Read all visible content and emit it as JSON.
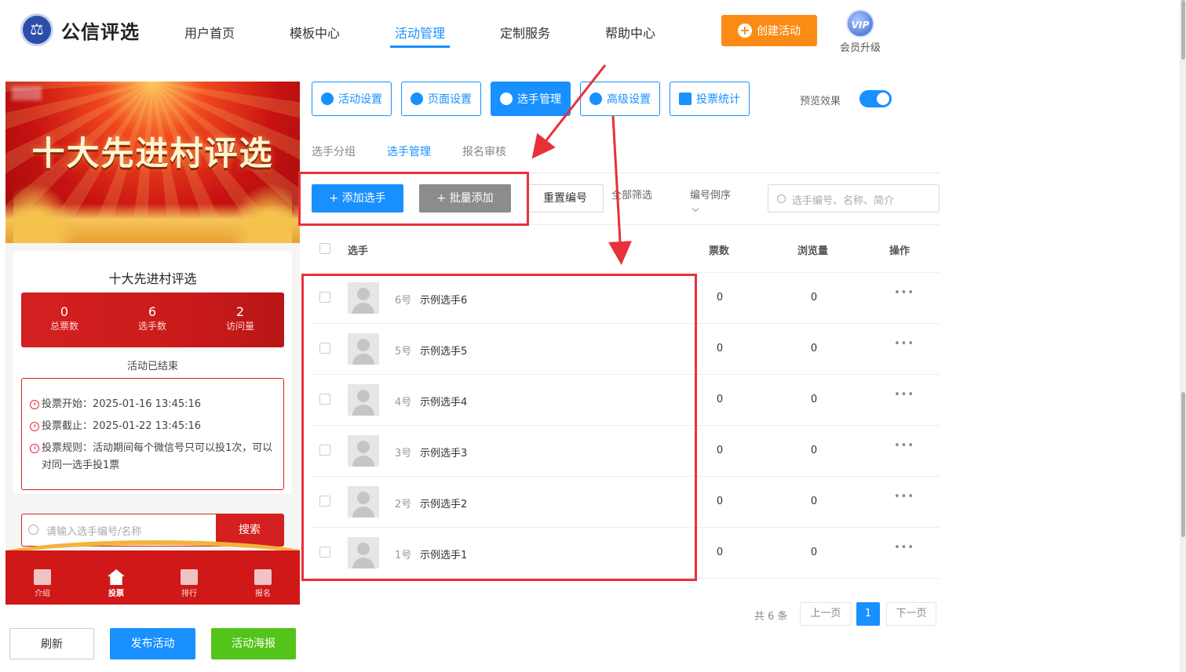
{
  "header": {
    "brand": "公信评选",
    "nav": [
      "用户首页",
      "模板中心",
      "活动管理",
      "定制服务",
      "帮助中心"
    ],
    "active_nav": "活动管理",
    "create_button": "创建活动",
    "vip_badge": "VIP",
    "vip_label": "会员升级"
  },
  "preview": {
    "banner_title": "十大先进村评选",
    "activity_title": "十大先进村评选",
    "stats": [
      {
        "value": "0",
        "label": "总票数"
      },
      {
        "value": "6",
        "label": "选手数"
      },
      {
        "value": "2",
        "label": "访问量"
      }
    ],
    "status": "活动已结束",
    "vote_start": "投票开始：2025-01-16 13:45:16",
    "vote_end": "投票截止：2025-01-22 13:45:16",
    "vote_rule": "投票规则：活动期间每个微信号只可以投1次，可以对同一选手投1票",
    "search_placeholder": "请输入选手编号/名称",
    "search_button": "搜索",
    "tabs": [
      "介绍",
      "投票",
      "排行",
      "报名"
    ],
    "active_tab": "投票"
  },
  "bottom_buttons": {
    "refresh": "刷新",
    "publish": "发布活动",
    "poster": "活动海报"
  },
  "settings_tabs": [
    "活动设置",
    "页面设置",
    "选手管理",
    "高级设置",
    "投票统计"
  ],
  "active_settings_tab": "选手管理",
  "preview_toggle": {
    "label": "预览效果",
    "on": true
  },
  "sub_tabs": [
    "选手分组",
    "选手管理",
    "报名审核"
  ],
  "active_sub_tab": "选手管理",
  "toolbar": {
    "add": "+ 添加选手",
    "batch": "+ 批量添加",
    "reset": "重置编号",
    "filter_all": "全部筛选",
    "sort": "编号倒序",
    "search_placeholder": "选手编号、名称、简介"
  },
  "table": {
    "headers": {
      "player": "选手",
      "votes": "票数",
      "views": "浏览量",
      "actions": "操作"
    },
    "rows": [
      {
        "no": "6号",
        "name": "示例选手6",
        "votes": "0",
        "views": "0",
        "more": "•••"
      },
      {
        "no": "5号",
        "name": "示例选手5",
        "votes": "0",
        "views": "0",
        "more": "•••"
      },
      {
        "no": "4号",
        "name": "示例选手4",
        "votes": "0",
        "views": "0",
        "more": "•••"
      },
      {
        "no": "3号",
        "name": "示例选手3",
        "votes": "0",
        "views": "0",
        "more": "•••"
      },
      {
        "no": "2号",
        "name": "示例选手2",
        "votes": "0",
        "views": "0",
        "more": "•••"
      },
      {
        "no": "1号",
        "name": "示例选手1",
        "votes": "0",
        "views": "0",
        "more": "•••"
      }
    ]
  },
  "pagination": {
    "total": "共 6 条",
    "prev": "上一页",
    "current": "1",
    "next": "下一页"
  },
  "colors": {
    "primary": "#1890ff",
    "accent_orange": "#fa8c16",
    "preview_red": "#d42020",
    "annotation_red": "#e8303a",
    "green": "#52c41a"
  }
}
